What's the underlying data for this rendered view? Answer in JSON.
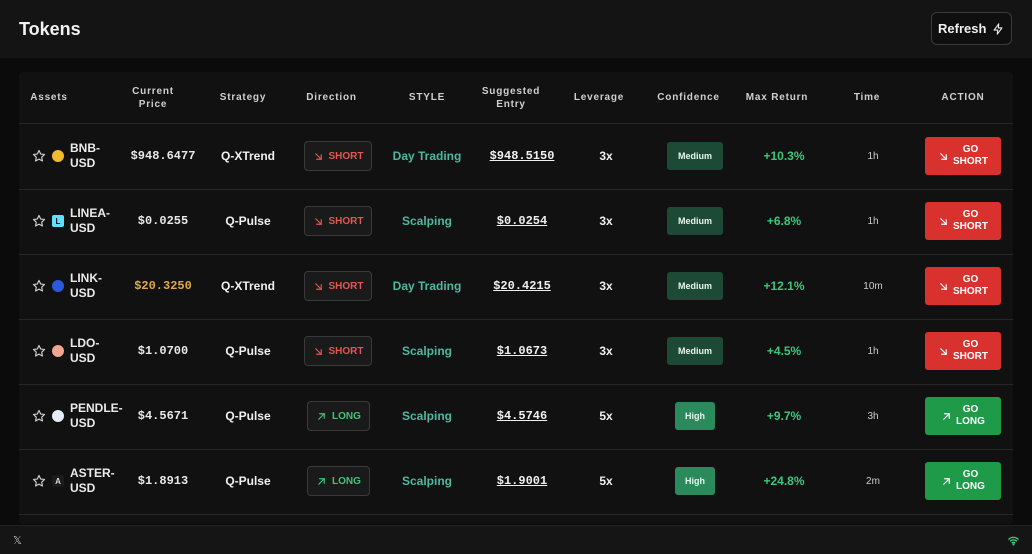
{
  "page": {
    "title": "Tokens",
    "refresh_label": "Refresh"
  },
  "colors": {
    "short": "#d9322e",
    "long": "#1f9a48",
    "style_text": "#4fb89f",
    "return_text": "#3cc77a",
    "medium_badge": "#1d4a36",
    "high_badge": "#2a8a5b"
  },
  "table": {
    "headers": {
      "assets": "Assets",
      "current_price_1": "Current",
      "current_price_2": "Price",
      "strategy": "Strategy",
      "direction": "Direction",
      "style": "STYLE",
      "suggested_entry_1": "Suggested",
      "suggested_entry_2": "Entry",
      "leverage": "Leverage",
      "confidence": "Confidence",
      "max_return": "Max Return",
      "time": "Time",
      "action": "ACTION"
    },
    "rows": [
      {
        "asset_line1": "BNB-",
        "asset_line2": "USD",
        "icon": "bnb-coin-icon",
        "icon_color": "#f3ba2f",
        "icon_glyph": "",
        "price": "$948.6477",
        "price_color": "#e8e8e8",
        "strategy": "Q-XTrend",
        "direction": "SHORT",
        "style": "Day Trading",
        "entry": "$948.5150",
        "leverage": "3x",
        "confidence": "Medium",
        "max_return": "+10.3%",
        "time": "1h",
        "action_line1": "GO",
        "action_line2": "SHORT"
      },
      {
        "asset_line1": "LINEA-",
        "asset_line2": "USD",
        "icon": "linea-coin-icon",
        "icon_color": "#61dfff",
        "icon_glyph": "L",
        "price": "$0.0255",
        "price_color": "#e8e8e8",
        "strategy": "Q-Pulse",
        "direction": "SHORT",
        "style": "Scalping",
        "entry": "$0.0254",
        "leverage": "3x",
        "confidence": "Medium",
        "max_return": "+6.8%",
        "time": "1h",
        "action_line1": "GO",
        "action_line2": "SHORT"
      },
      {
        "asset_line1": "LINK-",
        "asset_line2": "USD",
        "icon": "link-coin-icon",
        "icon_color": "#2a5ada",
        "icon_glyph": "",
        "price": "$20.3250",
        "price_color": "#e0a84a",
        "strategy": "Q-XTrend",
        "direction": "SHORT",
        "style": "Day Trading",
        "entry": "$20.4215",
        "leverage": "3x",
        "confidence": "Medium",
        "max_return": "+12.1%",
        "time": "10m",
        "action_line1": "GO",
        "action_line2": "SHORT"
      },
      {
        "asset_line1": "LDO-",
        "asset_line2": "USD",
        "icon": "ldo-coin-icon",
        "icon_color": "#f2a58f",
        "icon_glyph": "",
        "price": "$1.0700",
        "price_color": "#e8e8e8",
        "strategy": "Q-Pulse",
        "direction": "SHORT",
        "style": "Scalping",
        "entry": "$1.0673",
        "leverage": "3x",
        "confidence": "Medium",
        "max_return": "+4.5%",
        "time": "1h",
        "action_line1": "GO",
        "action_line2": "SHORT"
      },
      {
        "asset_line1": "PENDLE-",
        "asset_line2": "USD",
        "icon": "pendle-coin-icon",
        "icon_color": "#e6ecf5",
        "icon_glyph": "",
        "price": "$4.5671",
        "price_color": "#e8e8e8",
        "strategy": "Q-Pulse",
        "direction": "LONG",
        "style": "Scalping",
        "entry": "$4.5746",
        "leverage": "5x",
        "confidence": "High",
        "max_return": "+9.7%",
        "time": "3h",
        "action_line1": "GO",
        "action_line2": "LONG"
      },
      {
        "asset_line1": "ASTER-",
        "asset_line2": "USD",
        "icon": "aster-coin-icon",
        "icon_color": "#1b1b1b",
        "icon_glyph": "A",
        "price": "$1.8913",
        "price_color": "#e8e8e8",
        "strategy": "Q-Pulse",
        "direction": "LONG",
        "style": "Scalping",
        "entry": "$1.9001",
        "leverage": "5x",
        "confidence": "High",
        "max_return": "+24.8%",
        "time": "2m",
        "action_line1": "GO",
        "action_line2": "LONG"
      }
    ]
  },
  "footer": {
    "left_icon": "x-logo-icon",
    "right_icon": "wifi-icon"
  }
}
